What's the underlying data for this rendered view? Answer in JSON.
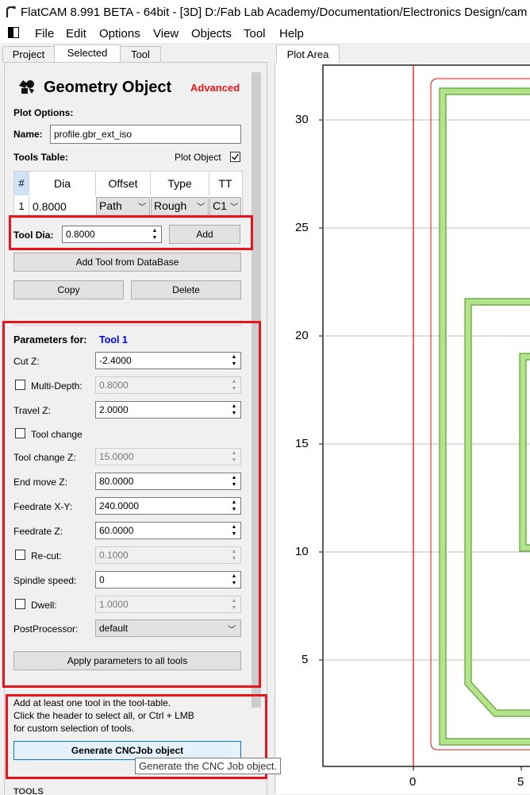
{
  "window": {
    "title": "FlatCAM 8.991 BETA - 64bit - [3D]    D:/Fab Lab Academy/Documentation/Electronics Design/cam"
  },
  "menu": [
    "File",
    "Edit",
    "Options",
    "View",
    "Objects",
    "Tool",
    "Help"
  ],
  "tabs": [
    "Project",
    "Selected",
    "Tool"
  ],
  "panel": {
    "title": "Geometry Object",
    "advanced": "Advanced",
    "plot_options": "Plot Options:",
    "name_label": "Name:",
    "name_value": "profile.gbr_ext_iso",
    "tools_table_label": "Tools Table:",
    "plot_object_label": "Plot Object",
    "table": {
      "headers": [
        "#",
        "Dia",
        "Offset",
        "Type",
        "TT"
      ],
      "row": [
        "1",
        "0.8000",
        "Path",
        "Rough",
        "C1"
      ]
    },
    "tool_dia_label": "Tool Dia:",
    "tool_dia_value": "0.8000",
    "add_button": "Add",
    "add_from_db_button": "Add Tool from DataBase",
    "copy_button": "Copy",
    "delete_button": "Delete",
    "params_label": "Parameters for:",
    "params_tool": "Tool 1",
    "params": {
      "cut_z": {
        "label": "Cut Z:",
        "value": "-2.4000"
      },
      "multi_depth": {
        "label": "Multi-Depth:",
        "value": "0.8000"
      },
      "travel_z": {
        "label": "Travel Z:",
        "value": "2.0000"
      },
      "tool_change": {
        "label": "Tool change"
      },
      "tool_change_z": {
        "label": "Tool change Z:",
        "value": "15.0000"
      },
      "end_move_z": {
        "label": "End move Z:",
        "value": "80.0000"
      },
      "feedrate_xy": {
        "label": "Feedrate X-Y:",
        "value": "240.0000"
      },
      "feedrate_z": {
        "label": "Feedrate Z:",
        "value": "60.0000"
      },
      "recut": {
        "label": "Re-cut:",
        "value": "0.1000"
      },
      "spindle": {
        "label": "Spindle speed:",
        "value": "0"
      },
      "dwell": {
        "label": "Dwell:",
        "value": "1.0000"
      },
      "postprocessor": {
        "label": "PostProcessor:",
        "value": "default"
      }
    },
    "apply_all_button": "Apply parameters to all tools",
    "hint_line1": "Add at least one tool in the tool-table.",
    "hint_line2": "Click the header to select all, or Ctrl + LMB",
    "hint_line3": "for custom selection of tools.",
    "generate_button": "Generate CNCJob object",
    "bottom_label": "TOOLS"
  },
  "plot": {
    "tab": "Plot Area",
    "y_ticks": [
      "30",
      "25",
      "20",
      "15",
      "10",
      "5"
    ],
    "x_ticks": [
      "0",
      "5"
    ]
  },
  "tooltip": "Generate the CNC Job object.",
  "colors": {
    "accent_red": "#e8141d",
    "tool_blue": "#0000ff",
    "path_green": "#b5e38c"
  },
  "icons": [
    "flatcam-logo-icon",
    "app-menu-icon",
    "geometry-object-icon",
    "checkbox-checked-icon",
    "spin-up-icon",
    "spin-down-icon",
    "dropdown-arrow-icon"
  ]
}
